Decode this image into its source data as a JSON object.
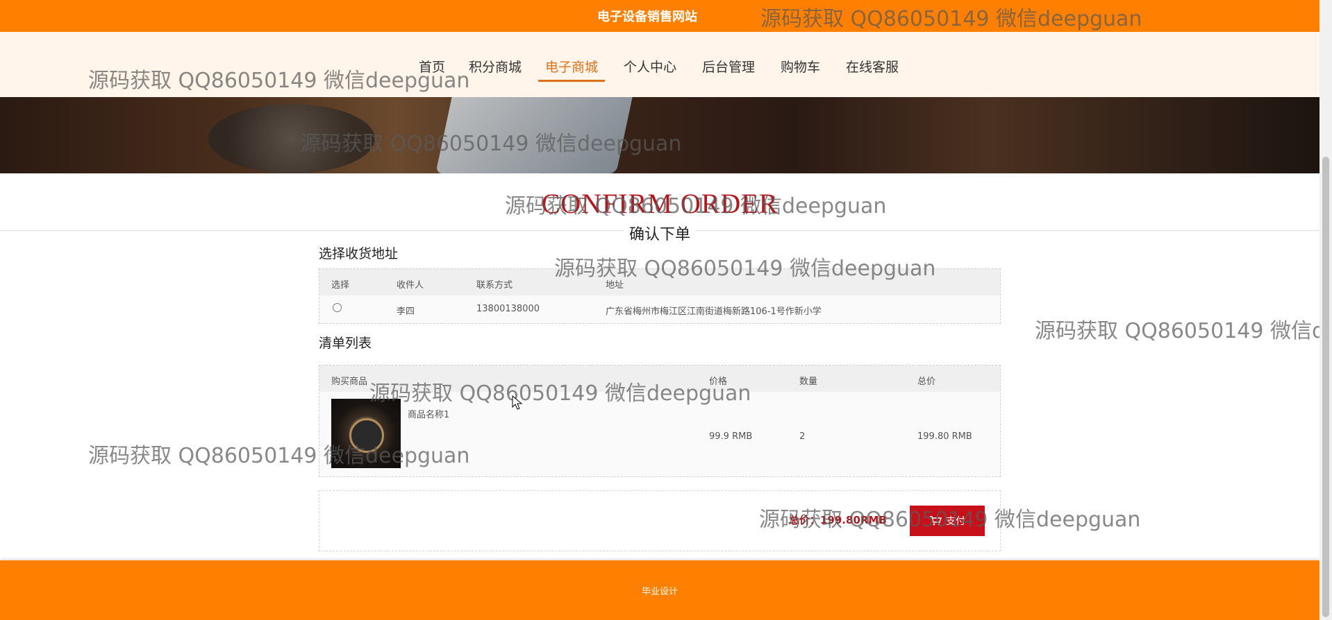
{
  "header": {
    "site_title": "电子设备销售网站"
  },
  "nav": {
    "items": [
      {
        "label": "首页",
        "active": false
      },
      {
        "label": "积分商城",
        "active": false
      },
      {
        "label": "电子商城",
        "active": true
      },
      {
        "label": "个人中心",
        "active": false
      },
      {
        "label": "后台管理",
        "active": false
      },
      {
        "label": "购物车",
        "active": false
      },
      {
        "label": "在线客服",
        "active": false
      }
    ]
  },
  "section": {
    "title_en": "CONFIRM ORDER",
    "title_cn": "确认下单"
  },
  "address": {
    "label": "选择收货地址",
    "columns": [
      "选择",
      "收件人",
      "联系方式",
      "地址"
    ],
    "rows": [
      {
        "recipient": "李四",
        "phone": "13800138000",
        "address": "广东省梅州市梅江区江南街道梅新路106-1号作新小学",
        "selected": false
      }
    ]
  },
  "items": {
    "label": "清单列表",
    "columns": [
      "购买商品",
      "价格",
      "数量",
      "总价"
    ],
    "rows": [
      {
        "name": "商品名称1",
        "price": "99.9 RMB",
        "quantity": "2",
        "total": "199.80 RMB",
        "image": "wristwatch-image"
      }
    ]
  },
  "summary": {
    "total_text": "总价：199.80RMB",
    "pay_label": "支付",
    "pay_icon": "cart-icon"
  },
  "footer": {
    "text": "毕业设计"
  },
  "watermark": {
    "text": "源码获取 QQ86050149 微信deepguan"
  },
  "colors": {
    "brand": "#ff7f00",
    "accent": "#b0191e",
    "pay": "#c8101a",
    "nav_active": "#e0711a"
  }
}
